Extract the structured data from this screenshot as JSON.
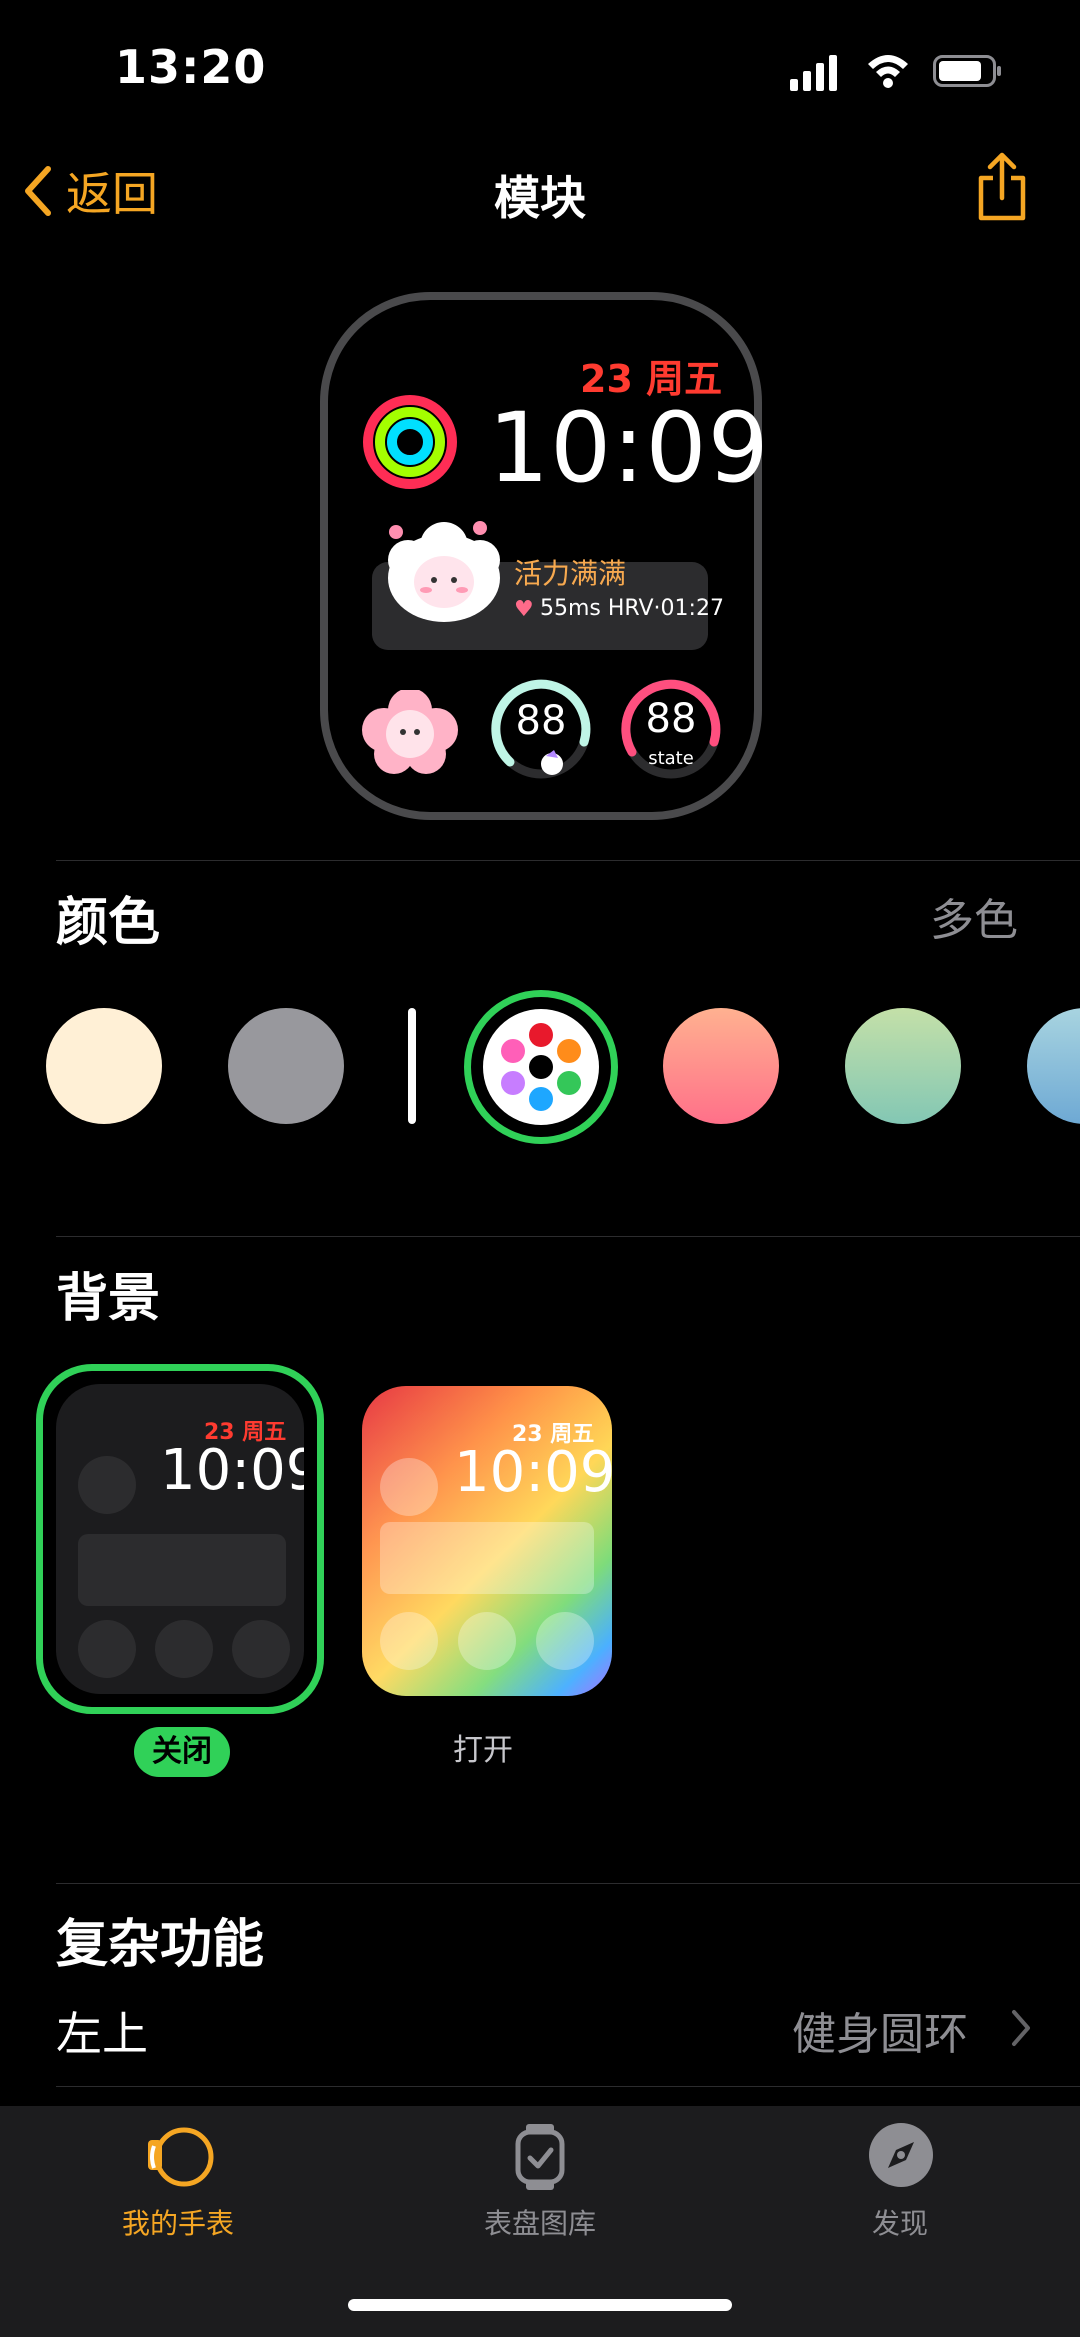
{
  "status": {
    "time": "13:20"
  },
  "nav": {
    "back_label": "返回",
    "title": "模块"
  },
  "watch_preview": {
    "date": "23 周五",
    "time": "10:09",
    "panel_title": "活力满满",
    "panel_detail": "55ms HRV·01:27",
    "gauge1_value": "88",
    "gauge2_value": "88",
    "gauge2_caption": "state"
  },
  "color_section": {
    "title": "颜色",
    "value": "多色",
    "swatches": [
      "#fff0d6",
      "#98989d",
      "multicolor",
      "#ff9a8b",
      "#a6d7a5",
      "#8ec1d6"
    ]
  },
  "background_section": {
    "title": "背景",
    "options": [
      {
        "label": "关闭",
        "date": "23 周五",
        "time": "10:09",
        "selected": true
      },
      {
        "label": "打开",
        "date": "23 周五",
        "time": "10:09",
        "selected": false
      }
    ]
  },
  "complications_section": {
    "title": "复杂功能",
    "rows": [
      {
        "label": "左上",
        "value": "健身圆环"
      }
    ]
  },
  "tabs": [
    {
      "label": "我的手表",
      "icon": "watch-icon",
      "active": true
    },
    {
      "label": "表盘图库",
      "icon": "watchface-gallery-icon",
      "active": false
    },
    {
      "label": "发现",
      "icon": "compass-icon",
      "active": false
    }
  ],
  "colors": {
    "accent": "#f5a623",
    "selected_ring": "#30d158",
    "date_red": "#ff3b30"
  }
}
